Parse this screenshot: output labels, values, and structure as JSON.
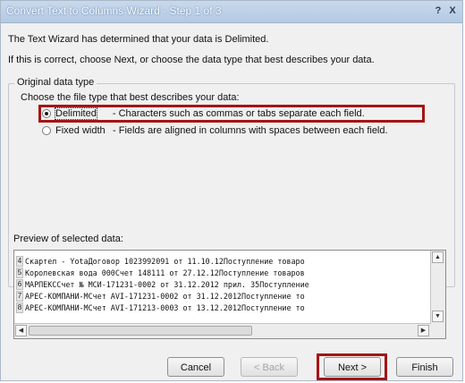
{
  "window": {
    "title": "Convert Text to Columns Wizard - Step 1 of 3",
    "help_label": "?",
    "close_label": "X"
  },
  "intro": {
    "line1": "The Text Wizard has determined that your data is Delimited.",
    "line2": "If this is correct, choose Next, or choose the data type that best describes your data."
  },
  "original_data_type": {
    "legend": "Original data type",
    "file_type_label": "Choose the file type that best describes your data:",
    "options": [
      {
        "name": "Delimited",
        "description": "- Characters such as commas or tabs separate each field.",
        "selected": true
      },
      {
        "name": "Fixed width",
        "description": "- Fields are aligned in columns with spaces between each field.",
        "selected": false
      }
    ]
  },
  "preview": {
    "label": "Preview of selected data:",
    "rows": [
      {
        "num": "4",
        "text": "Скартел - YotaДоговор 1023992091 от 11.10.12Поступление товаро"
      },
      {
        "num": "5",
        "text": "Королевская вода 000Счет 148111 от 27.12.12Поступление товаров"
      },
      {
        "num": "6",
        "text": "МАРПЕКССчет № МСИ-171231-0002 от 31.12.2012 прил. 35Поступление"
      },
      {
        "num": "7",
        "text": "АРЕС-КОМПАНИ-МСчет AVI-171231-0002 от 31.12.2012Поступление то"
      },
      {
        "num": "8",
        "text": "АРЕС-КОМПАНИ-МСчет AVI-171213-0003 от 13.12.2012Поступление то"
      }
    ]
  },
  "buttons": {
    "cancel": "Cancel",
    "back": "< Back",
    "next": "Next >",
    "finish": "Finish"
  }
}
